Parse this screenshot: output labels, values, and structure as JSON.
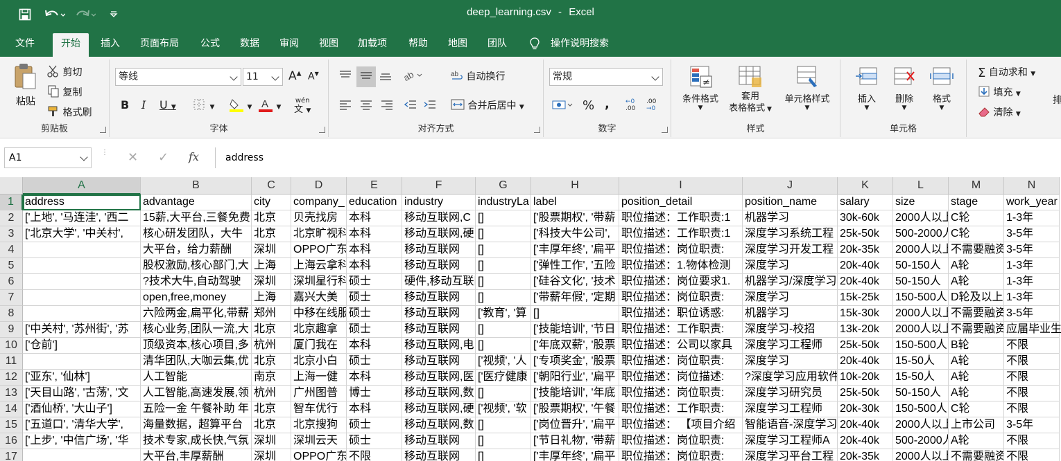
{
  "window": {
    "title": "deep_learning.csv",
    "app": "Excel",
    "separator": "-"
  },
  "qat": {
    "save_icon": "save-icon",
    "undo_icon": "undo-icon",
    "redo_icon": "redo-icon",
    "customize_icon": "customize-qat-icon"
  },
  "tabs": [
    "文件",
    "开始",
    "插入",
    "页面布局",
    "公式",
    "数据",
    "审阅",
    "视图",
    "加载项",
    "帮助",
    "地图",
    "团队"
  ],
  "active_tab": "开始",
  "tell_me": "操作说明搜索",
  "ribbon": {
    "clipboard": {
      "paste": "粘贴",
      "cut": "剪切",
      "copy": "复制",
      "format_painter": "格式刷",
      "label": "剪贴板"
    },
    "font": {
      "font_name": "等线",
      "font_size": "11",
      "bold": "B",
      "italic": "I",
      "underline": "U",
      "label": "字体",
      "grow": "A",
      "shrink": "A",
      "wen": "wén",
      "wen_char": "文"
    },
    "alignment": {
      "wrap_text": "自动换行",
      "merge_center": "合并后居中",
      "label": "对齐方式"
    },
    "number": {
      "format": "常规",
      "percent": "%",
      "comma": ",",
      "inc_decimal_top": "←0",
      "inc_decimal_bot": ".00",
      "dec_decimal_top": ".00",
      "dec_decimal_bot": "→0",
      "label": "数字"
    },
    "styles": {
      "conditional": "条件格式",
      "table1": "套用",
      "table2": "表格格式",
      "cell_styles": "单元格样式",
      "label": "样式"
    },
    "cells": {
      "insert": "插入",
      "delete": "删除",
      "format": "格式",
      "label": "单元格"
    },
    "editing": {
      "autosum": "自动求和",
      "fill": "填充",
      "clear": "清除",
      "partial": "排"
    }
  },
  "formula_bar": {
    "name_box": "A1",
    "fx": "fx",
    "content": "address"
  },
  "columns": [
    "A",
    "B",
    "C",
    "D",
    "E",
    "F",
    "G",
    "H",
    "I",
    "J",
    "K",
    "L",
    "M",
    "N"
  ],
  "rows": [
    "1",
    "2",
    "3",
    "4",
    "5",
    "6",
    "7",
    "8",
    "9",
    "10",
    "11",
    "12",
    "13",
    "14",
    "15",
    "16",
    "17"
  ],
  "cells": [
    [
      "address",
      "advantage",
      "city",
      "company_",
      "education",
      "industry",
      "industryLa",
      "label",
      "position_detail",
      "position_name",
      "salary",
      "size",
      "stage",
      "work_year"
    ],
    [
      "['上地', '马连洼', '西二",
      "15薪,大平台,三餐免费",
      "北京",
      "贝壳找房",
      "本科",
      "移动互联网,C",
      "[]",
      "['股票期权', '带薪",
      "职位描述：工作职责:1",
      "机器学习",
      "30k-60k",
      "2000人以上",
      "C轮",
      "1-3年"
    ],
    [
      "['北京大学', '中关村',",
      "核心研发团队，大牛",
      "北京",
      "北京旷视科",
      "本科",
      "移动互联网,硬",
      "[]",
      "['科技大牛公司',",
      "职位描述：工作职责:1",
      "深度学习系统工程",
      "25k-50k",
      "500-2000人",
      "C轮",
      "3-5年"
    ],
    [
      "",
      "大平台，给力薪酬",
      "深圳",
      "OPPO广东",
      "本科",
      "移动互联网",
      "[]",
      "['丰厚年终', '扁平",
      "职位描述：岗位职责:",
      "深度学习开发工程",
      "20k-35k",
      "2000人以上",
      "不需要融资",
      "3-5年"
    ],
    [
      "",
      "股权激励,核心部门,大",
      "上海",
      "上海云拿科",
      "本科",
      "移动互联网",
      "[]",
      "['弹性工作', '五险",
      "职位描述：1.物体检测",
      "深度学习",
      "20k-40k",
      "50-150人",
      "A轮",
      "1-3年"
    ],
    [
      "",
      "?技术大牛,自动驾驶",
      "深圳",
      "深圳星行科",
      "硕士",
      "硬件,移动互联网",
      "[]",
      "['硅谷文化', '技术",
      "职位描述：岗位要求1.",
      "机器学习/深度学习",
      "20k-40k",
      "50-150人",
      "A轮",
      "1-3年"
    ],
    [
      "",
      "open,free,money",
      "上海",
      "嘉兴大美",
      "硕士",
      "移动互联网",
      "[]",
      "['带薪年假', '定期",
      "职位描述：岗位职责:",
      "深度学习",
      "15k-25k",
      "150-500人",
      "D轮及以上",
      "1-3年"
    ],
    [
      "",
      "六险两金,扁平化,带薪",
      "郑州",
      "中移在线服",
      "硕士",
      "移动互联网",
      "['教育', '算",
      "[]",
      "职位描述：职位诱惑:",
      "机器学习",
      "15k-30k",
      "2000人以上",
      "不需要融资",
      "3-5年"
    ],
    [
      "['中关村', '苏州街', '苏",
      "核心业务,团队一流,大",
      "北京",
      "北京趣拿",
      "硕士",
      "移动互联网",
      "[]",
      "['技能培训', '节日",
      "职位描述：工作职责:",
      "深度学习-校招",
      "13k-20k",
      "2000人以上",
      "不需要融资",
      "应届毕业生"
    ],
    [
      "['仓前']",
      "顶级资本,核心项目,多",
      "杭州",
      "厦门我在",
      "本科",
      "移动互联网,电",
      "[]",
      "['年底双薪', '股票",
      "职位描述：公司以家具",
      "深度学习工程师",
      "25k-50k",
      "150-500人",
      "B轮",
      "不限"
    ],
    [
      "",
      "清华团队,大咖云集,优",
      "北京",
      "北京小白",
      "硕士",
      "移动互联网",
      "['视频', '人",
      "['专项奖金', '股票",
      "职位描述：岗位职责:",
      "深度学习",
      "20k-40k",
      "15-50人",
      "A轮",
      "不限"
    ],
    [
      "['亚东', '仙林']",
      "人工智能",
      "南京",
      "上海一健",
      "本科",
      "移动互联网,医",
      "['医疗健康",
      "['朝阳行业', '扁平",
      "职位描述：岗位描述:",
      "?深度学习应用软件",
      "10k-20k",
      "15-50人",
      "A轮",
      "不限"
    ],
    [
      "['天目山路', '古荡', '文",
      "人工智能,高速发展,领",
      "杭州",
      "广州图普",
      "博士",
      "移动互联网,数",
      "[]",
      "['技能培训', '年底",
      "职位描述：岗位职责:",
      "深度学习研究员",
      "25k-50k",
      "50-150人",
      "A轮",
      "不限"
    ],
    [
      "['酒仙桥', '大山子']",
      "五险一金 午餐补助 年",
      "北京",
      "智车优行",
      "本科",
      "移动互联网,硬",
      "['视频', '软",
      "['股票期权', '午餐",
      "职位描述：工作职责:",
      "深度学习工程师",
      "20k-30k",
      "150-500人",
      "C轮",
      "不限"
    ],
    [
      "['五道口', '清华大学',",
      "海量数据，超算平台",
      "北京",
      "北京搜狗",
      "硕士",
      "移动互联网,数",
      "[]",
      "['岗位晋升', '扁平",
      "职位描述：  【项目介绍",
      "智能语音-深度学习",
      "20k-40k",
      "2000人以上",
      "上市公司",
      "3-5年"
    ],
    [
      "['上步', '中信广场', '华",
      "技术专家,成长快,气氛",
      "深圳",
      "深圳云天",
      "硕士",
      "移动互联网",
      "[]",
      "['节日礼物', '带薪",
      "职位描述：岗位职责:",
      "深度学习工程师A",
      "20k-40k",
      "500-2000人",
      "A轮",
      "不限"
    ],
    [
      "",
      "大平台,丰厚薪酬",
      "深圳",
      "OPPO广东",
      "不限",
      "移动互联网",
      "[]",
      "['丰厚年终', '扁平",
      "职位描述：岗位职责:",
      "深度学习平台工程",
      "20k-35k",
      "2000人以上",
      "不需要融资",
      "不限"
    ]
  ],
  "colors": {
    "excel_green": "#217346",
    "ribbon_bg": "#f3f3f3",
    "header_bg": "#e6e6e6",
    "grid_line": "#d4d4d4"
  }
}
